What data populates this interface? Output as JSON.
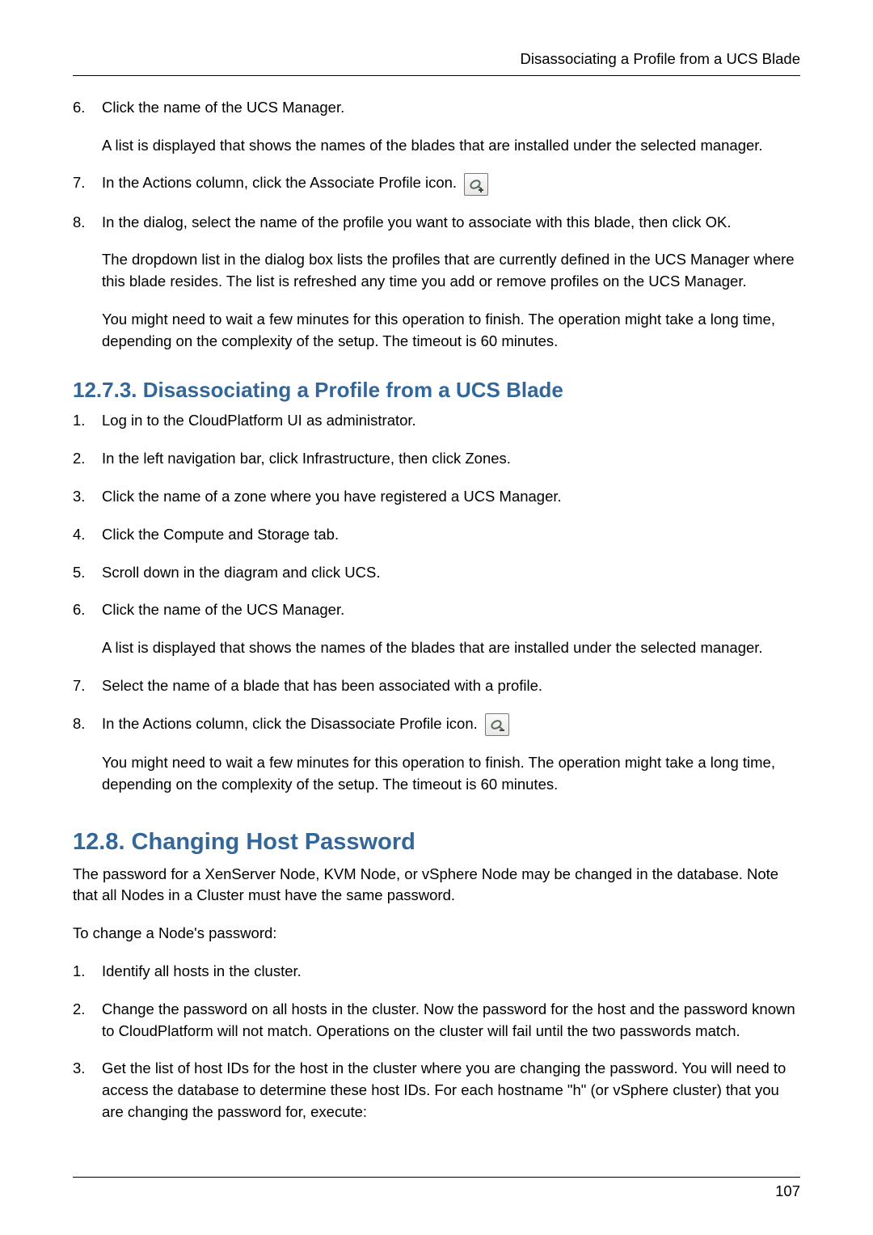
{
  "runningHead": "Disassociating a Profile from a UCS Blade",
  "pageNumber": "107",
  "topList": {
    "i6": {
      "num": "6.",
      "p1": "Click the name of the UCS Manager.",
      "p2": "A list is displayed that shows the names of the blades that are installed under the selected manager."
    },
    "i7": {
      "num": "7.",
      "p1": "In the Actions column, click the Associate Profile icon."
    },
    "i8": {
      "num": "8.",
      "p1": "In the dialog, select the name of the profile you want to associate with this blade, then click OK.",
      "p2": "The dropdown list in the dialog box lists the profiles that are currently defined in the UCS Manager where this blade resides. The list is refreshed any time you add or remove profiles on the UCS Manager.",
      "p3": "You might need to wait a few minutes for this operation to finish. The operation might take a long time, depending on the complexity of the setup. The timeout is 60 minutes."
    }
  },
  "sec1273": {
    "heading": "12.7.3. Disassociating a Profile from a UCS Blade",
    "i1": {
      "num": "1.",
      "p1": "Log in to the CloudPlatform UI as administrator."
    },
    "i2": {
      "num": "2.",
      "p1": "In the left navigation bar, click Infrastructure, then click Zones."
    },
    "i3": {
      "num": "3.",
      "p1": "Click the name of a zone where you have registered a UCS Manager."
    },
    "i4": {
      "num": "4.",
      "p1": "Click the Compute and Storage tab."
    },
    "i5": {
      "num": "5.",
      "p1": "Scroll down in the diagram and click UCS."
    },
    "i6": {
      "num": "6.",
      "p1": "Click the name of the UCS Manager.",
      "p2": "A list is displayed that shows the names of the blades that are installed under the selected manager."
    },
    "i7": {
      "num": "7.",
      "p1": "Select the name of a blade that has been associated with a profile."
    },
    "i8": {
      "num": "8.",
      "p1": "In the Actions column, click the Disassociate Profile icon.",
      "p2": "You might need to wait a few minutes for this operation to finish. The operation might take a long time, depending on the complexity of the setup. The timeout is 60 minutes."
    }
  },
  "sec128": {
    "heading": "12.8. Changing Host Password",
    "intro1": "The password for a XenServer Node, KVM Node, or vSphere Node may be changed in the database. Note that all Nodes in a Cluster must have the same password.",
    "intro2": "To change a Node's password:",
    "i1": {
      "num": "1.",
      "p1": "Identify all hosts in the cluster."
    },
    "i2": {
      "num": "2.",
      "p1": "Change the password on all hosts in the cluster. Now the password for the host and the password known to CloudPlatform will not match. Operations on the cluster will fail until the two passwords match."
    },
    "i3": {
      "num": "3.",
      "p1": "Get the list of host IDs for the host in the cluster where you are changing the password. You will need to access the database to determine these host IDs. For each hostname \"h\" (or vSphere cluster) that you are changing the password for, execute:"
    }
  }
}
